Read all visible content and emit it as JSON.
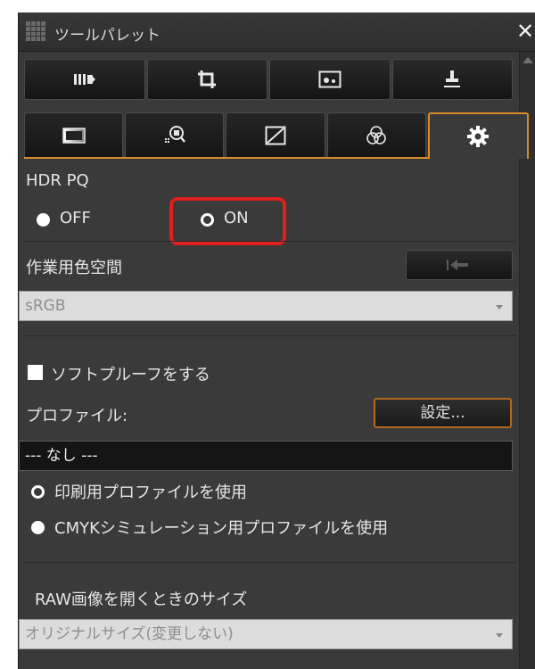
{
  "window": {
    "title": "ツールパレット",
    "close_label": "✕"
  },
  "toolbar": {
    "icons": [
      "histogram-panel-icon",
      "crop-icon",
      "image-mask-icon",
      "stamp-icon"
    ]
  },
  "tabs": {
    "icons": [
      "tone-icon",
      "color-pick-icon",
      "curve-icon",
      "color-balance-icon",
      "settings-gear-icon"
    ],
    "active_index": 4
  },
  "hdr": {
    "label": "HDR PQ",
    "off_label": "OFF",
    "on_label": "ON",
    "selected": "ON"
  },
  "workspace": {
    "label": "作業用色空間",
    "value": "sRGB"
  },
  "softproof": {
    "checkbox_label": "ソフトプルーフをする",
    "profile_label": "プロファイル:",
    "settings_button": "設定...",
    "profile_value": "--- なし ---",
    "option_print": "印刷用プロファイルを使用",
    "option_cmyk": "CMYKシミュレーション用プロファイルを使用"
  },
  "raw": {
    "label": "RAW画像を開くときのサイズ",
    "value": "オリジナルサイズ(変更しない)"
  },
  "colors": {
    "accent": "#d88a2a",
    "highlight": "#e0201c",
    "panel_bg": "#3a3a3a"
  }
}
